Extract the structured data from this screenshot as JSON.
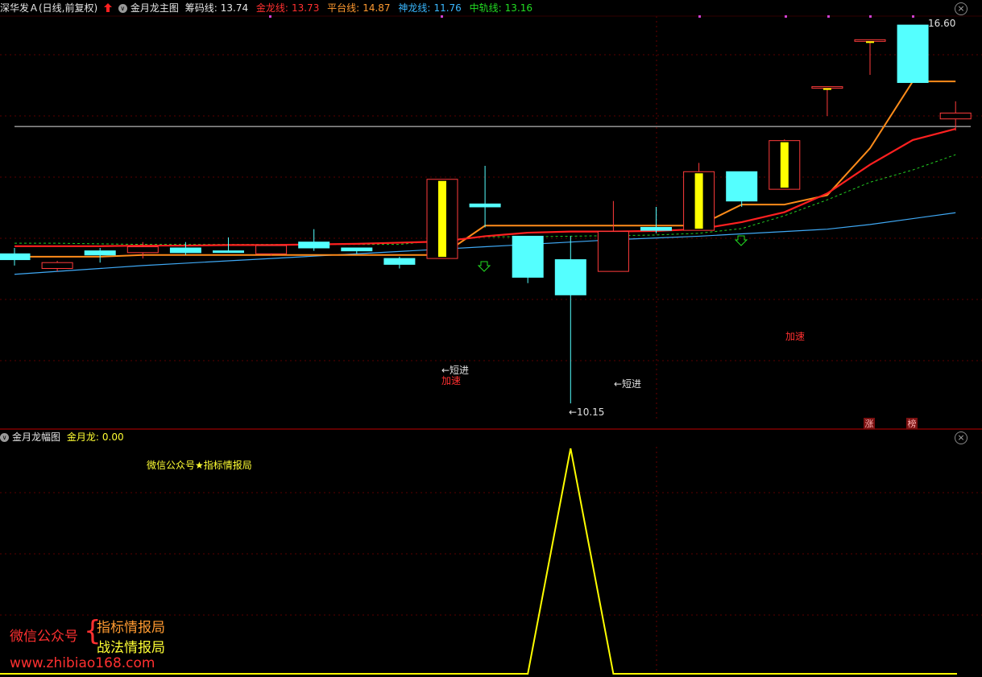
{
  "main_header": {
    "stock": "深华发Ａ(日线,前复权)",
    "indicator_name": "金月龙主图",
    "chip_label": "筹码线:",
    "chip_value": "13.74",
    "gold_label": "金龙线:",
    "gold_value": "13.73",
    "plat_label": "平台线:",
    "plat_value": "14.87",
    "shen_label": "神龙线:",
    "shen_value": "11.76",
    "mid_label": "中轨线:",
    "mid_value": "13.16"
  },
  "sub_header": {
    "indicator_name": "金月龙幅图",
    "label": "金月龙:",
    "value": "0.00"
  },
  "chart_labels": {
    "high_price": "16.60",
    "low_price": "←10.15",
    "short_entry_1": "←短进",
    "short_entry_2": "←短进",
    "accelerate_1": "加速",
    "accelerate_2": "加速",
    "badge_1": "涨",
    "badge_2": "榜",
    "sub_watermark": "微信公众号★指标情报局"
  },
  "watermark": {
    "wechat": "微信公众号",
    "line1": "指标情报局",
    "line2": "战法情报局",
    "url": "www.zhibiao168.com"
  },
  "colors": {
    "up": "#ff3b3b",
    "down": "#54ffff",
    "yellow": "#ffff00",
    "gold_line": "#ff2020",
    "platform_line": "#ff8c1a",
    "shenlong_line": "#3fa9f5",
    "mid_line": "#22cc22"
  },
  "chart_data": {
    "type": "candlestick",
    "candles": [
      {
        "o": 12.7,
        "h": 12.8,
        "l": 12.5,
        "c": 12.6
      },
      {
        "o": 12.45,
        "h": 12.58,
        "l": 12.4,
        "c": 12.55
      },
      {
        "o": 12.75,
        "h": 12.8,
        "l": 12.55,
        "c": 12.68
      },
      {
        "o": 12.72,
        "h": 12.9,
        "l": 12.62,
        "c": 12.82
      },
      {
        "o": 12.8,
        "h": 12.9,
        "l": 12.68,
        "c": 12.72
      },
      {
        "o": 12.75,
        "h": 12.98,
        "l": 12.72,
        "c": 12.74
      },
      {
        "o": 12.7,
        "h": 12.84,
        "l": 12.67,
        "c": 12.84
      },
      {
        "o": 12.9,
        "h": 13.12,
        "l": 12.75,
        "c": 12.8
      },
      {
        "o": 12.8,
        "h": 12.8,
        "l": 12.7,
        "c": 12.75
      },
      {
        "o": 12.62,
        "h": 12.65,
        "l": 12.45,
        "c": 12.52
      },
      {
        "o": 12.62,
        "h": 13.97,
        "l": 12.62,
        "c": 13.97
      },
      {
        "o": 13.55,
        "h": 14.2,
        "l": 13.15,
        "c": 13.5
      },
      {
        "o": 13.0,
        "h": 13.0,
        "l": 12.2,
        "c": 12.3
      },
      {
        "o": 12.6,
        "h": 13.0,
        "l": 10.15,
        "c": 12.0
      },
      {
        "o": 12.4,
        "h": 13.6,
        "l": 12.4,
        "c": 13.08
      },
      {
        "o": 13.15,
        "h": 13.5,
        "l": 13.05,
        "c": 13.1
      },
      {
        "o": 13.1,
        "h": 14.25,
        "l": 13.1,
        "c": 14.1
      },
      {
        "o": 14.1,
        "h": 14.1,
        "l": 13.5,
        "c": 13.6
      },
      {
        "o": 13.8,
        "h": 14.65,
        "l": 13.8,
        "c": 14.63
      },
      {
        "o": 15.55,
        "h": 15.55,
        "l": 15.05,
        "c": 15.55
      },
      {
        "o": 16.35,
        "h": 16.35,
        "l": 15.75,
        "c": 16.35
      },
      {
        "o": 16.6,
        "h": 16.6,
        "l": 15.62,
        "c": 15.62
      },
      {
        "o": 15.0,
        "h": 15.3,
        "l": 14.8,
        "c": 15.1
      }
    ],
    "gold_line": [
      12.83,
      12.83,
      12.83,
      12.84,
      12.84,
      12.85,
      12.85,
      12.86,
      12.87,
      12.89,
      12.91,
      13.0,
      13.06,
      13.08,
      13.08,
      13.09,
      13.12,
      13.24,
      13.41,
      13.73,
      14.22,
      14.64,
      14.83
    ],
    "platform_line": [
      12.65,
      12.65,
      12.65,
      12.68,
      12.68,
      12.68,
      12.68,
      12.68,
      12.68,
      12.68,
      12.68,
      13.18,
      13.18,
      13.18,
      13.18,
      13.18,
      13.18,
      13.54,
      13.54,
      13.7,
      14.5,
      15.64,
      15.64
    ],
    "shenlong_line": [
      12.35,
      12.4,
      12.45,
      12.5,
      12.54,
      12.58,
      12.62,
      12.66,
      12.7,
      12.74,
      12.78,
      12.82,
      12.86,
      12.9,
      12.94,
      12.97,
      13.0,
      13.04,
      13.08,
      13.12,
      13.2,
      13.3,
      13.4
    ],
    "mid_line": [
      12.88,
      12.88,
      12.87,
      12.86,
      12.86,
      12.86,
      12.86,
      12.86,
      12.86,
      12.86,
      12.93,
      12.99,
      12.99,
      13.0,
      13.01,
      13.02,
      13.05,
      13.13,
      13.35,
      13.62,
      13.92,
      14.13,
      14.39
    ],
    "reference_price": 14.87,
    "sub_values": [
      0,
      0,
      0,
      0,
      0,
      0,
      0,
      0,
      0,
      0,
      0,
      0,
      0,
      1,
      0,
      0,
      0,
      0,
      0,
      0,
      0,
      0,
      0
    ]
  }
}
